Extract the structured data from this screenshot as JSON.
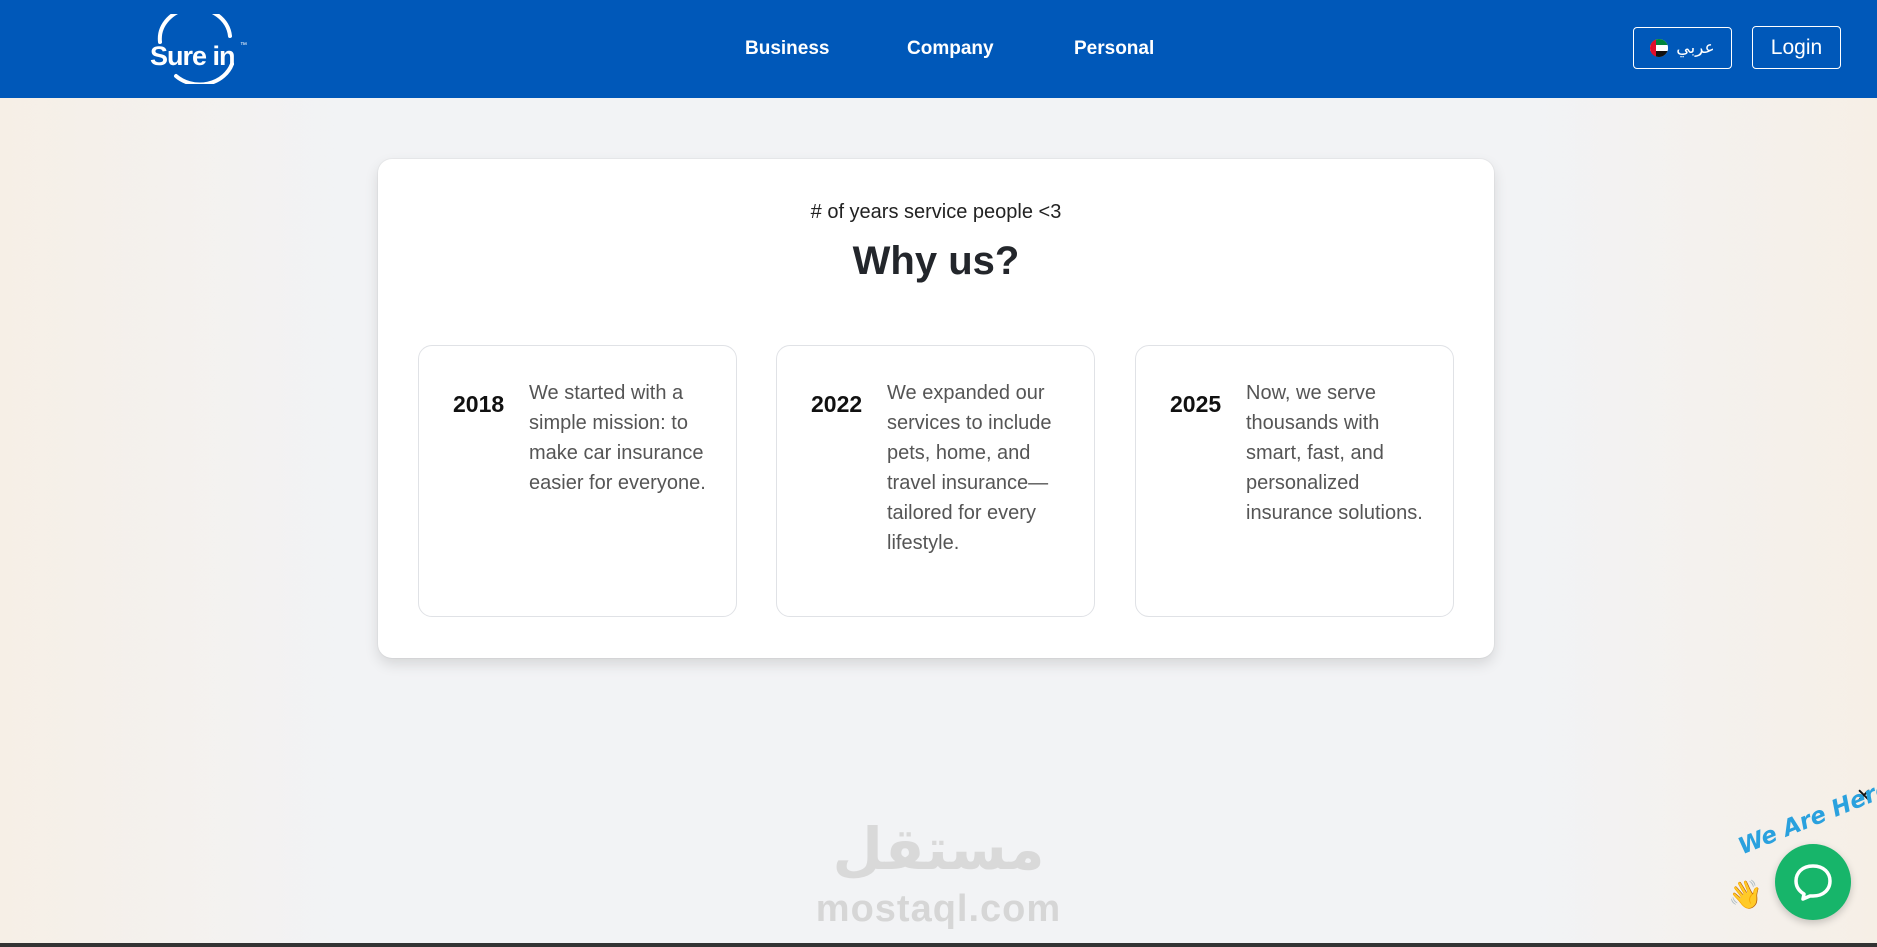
{
  "header": {
    "logo_text": "Sure in",
    "logo_tm": "™",
    "nav": [
      {
        "label": "Business"
      },
      {
        "label": "Company"
      },
      {
        "label": "Personal"
      }
    ],
    "language_label": "عربي",
    "login_label": "Login",
    "brand_color": "#0058b9"
  },
  "why_us": {
    "subtitle": "# of years service people <3",
    "title": "Why us?",
    "timeline": [
      {
        "year": "2018",
        "text": "We started with a simple mission: to make car insurance easier for everyone."
      },
      {
        "year": "2022",
        "text": "We expanded our services to include pets, home, and travel insurance—tailored for every lifestyle."
      },
      {
        "year": "2025",
        "text": "Now, we serve thousands with smart, fast, and personalized insurance solutions."
      }
    ]
  },
  "watermark": {
    "arabic": "مستقل",
    "english": "mostaql.com"
  },
  "chat": {
    "badge_text": "We Are Here!",
    "close_icon": "close-icon",
    "button_icon": "chat-bubble-icon",
    "color": "#17b56a"
  }
}
